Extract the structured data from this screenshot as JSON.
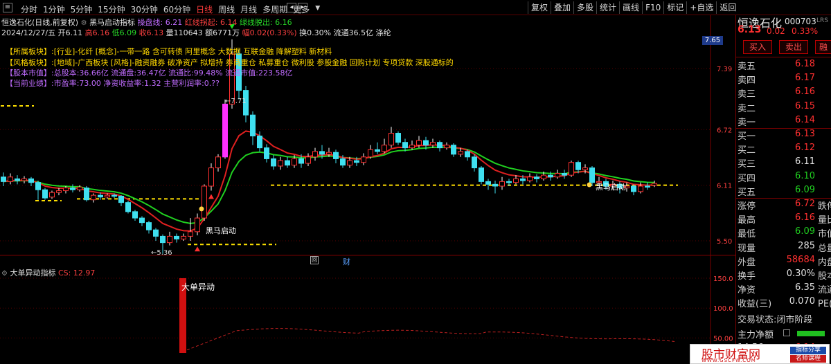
{
  "menu": {
    "period_tabs": [
      "分时",
      "1分钟",
      "5分钟",
      "15分钟",
      "30分钟",
      "60分钟",
      "日线",
      "周线",
      "月线",
      "多周期",
      "更多"
    ],
    "active_tab": "日线",
    "more_arrow": "▼",
    "right_tools": [
      "复权",
      "叠加",
      "多股",
      "统计",
      "画线",
      "F10",
      "标记",
      "+自选",
      "返回"
    ],
    "left_icon": "menu-icon",
    "nav_left_icon": "◂",
    "nav_right_icon": "▸"
  },
  "stock_header": {
    "title": "恒逸石化(日线,前复权)",
    "indicator": "黑马启动指标",
    "ind_caopan": "操盘线: 6.21",
    "ind_red": "红线拐起: 6.14",
    "ind_green": "绿线脱出: 6.16",
    "date": "2024/12/27/五",
    "open": "开6.11",
    "high": "高6.16",
    "low": "低6.09",
    "close": "收6.13",
    "volume": "量110643",
    "amount": "额6771万",
    "change": "幅0.02(0.33%)",
    "turnover": "换0.30%",
    "float_cap": "流通36.5亿",
    "industry_tag": "涤纶"
  },
  "info_panel": {
    "sector_label": "【所属板块】:",
    "sector_text": "[行业]-化纤 [概念]-一带一路 含可转债 阿里概念 大数据 互联金融 降解塑料 新材料",
    "style_label": "【风格板块】:",
    "style_text": "[地域]-广西板块 [风格]-融资融券 破净资产 拟增持 券商重仓 私募重仓 微利股 参股金融 回购计划 专项贷款 深股通标的",
    "capital_label": "【股本市值】:",
    "capital_text": "总股本:36.66亿 流通盘:36.47亿 流通比:99.48% 流通市值:223.58亿",
    "perf_label": "【当前业绩】:",
    "perf_text": "市盈率:73.00 净资收益率:1.32 主营利润率:0.??"
  },
  "chart_annotations": {
    "high_label": "7.71",
    "low_label": "5.36",
    "signal_label_1": "黑马启动",
    "signal_label_2": "黑马启动",
    "price_tag": "7.65",
    "event_box": "回",
    "event_cai": "财"
  },
  "chart_data": {
    "type": "candlestick",
    "y_ticks": [
      "7.39",
      "6.72",
      "6.11",
      "5.50"
    ],
    "candles": [
      {
        "o": 6.2,
        "c": 6.15,
        "h": 6.25,
        "l": 6.1
      },
      {
        "o": 6.15,
        "c": 6.2,
        "h": 6.24,
        "l": 6.12
      },
      {
        "o": 6.18,
        "c": 6.16,
        "h": 6.22,
        "l": 6.12
      },
      {
        "o": 6.16,
        "c": 6.18,
        "h": 6.21,
        "l": 6.13
      },
      {
        "o": 6.18,
        "c": 6.14,
        "h": 6.2,
        "l": 6.1
      },
      {
        "o": 6.14,
        "c": 6.06,
        "h": 6.16,
        "l": 5.95
      },
      {
        "o": 6.06,
        "c": 5.97,
        "h": 6.08,
        "l": 5.95
      },
      {
        "o": 5.98,
        "c": 6.03,
        "h": 6.05,
        "l": 5.96
      },
      {
        "o": 6.03,
        "c": 6.05,
        "h": 6.08,
        "l": 6.0
      },
      {
        "o": 6.05,
        "c": 6.08,
        "h": 6.1,
        "l": 6.02
      },
      {
        "o": 6.08,
        "c": 6.06,
        "h": 6.12,
        "l": 6.03
      },
      {
        "o": 6.06,
        "c": 6.09,
        "h": 6.11,
        "l": 6.04
      },
      {
        "o": 6.08,
        "c": 5.95,
        "h": 6.1,
        "l": 5.93
      },
      {
        "o": 5.95,
        "c": 6.0,
        "h": 6.02,
        "l": 5.92
      },
      {
        "o": 6.0,
        "c": 5.98,
        "h": 6.03,
        "l": 5.95
      },
      {
        "o": 5.98,
        "c": 6.0,
        "h": 6.02,
        "l": 5.96
      },
      {
        "o": 6.0,
        "c": 5.99,
        "h": 6.02,
        "l": 5.97
      },
      {
        "o": 5.99,
        "c": 5.92,
        "h": 6.0,
        "l": 5.88
      },
      {
        "o": 5.92,
        "c": 5.82,
        "h": 5.94,
        "l": 5.8
      },
      {
        "o": 5.82,
        "c": 5.75,
        "h": 5.84,
        "l": 5.72
      },
      {
        "o": 5.75,
        "c": 5.7,
        "h": 5.77,
        "l": 5.66
      },
      {
        "o": 5.7,
        "c": 5.62,
        "h": 5.72,
        "l": 5.58
      },
      {
        "o": 5.62,
        "c": 5.55,
        "h": 5.64,
        "l": 5.5
      },
      {
        "o": 5.55,
        "c": 5.48,
        "h": 5.57,
        "l": 5.36
      },
      {
        "o": 5.48,
        "c": 5.55,
        "h": 5.6,
        "l": 5.45
      },
      {
        "o": 5.55,
        "c": 5.52,
        "h": 5.58,
        "l": 5.48
      },
      {
        "o": 5.52,
        "c": 5.55,
        "h": 5.58,
        "l": 5.5
      },
      {
        "o": 5.55,
        "c": 5.6,
        "h": 5.75,
        "l": 5.5
      },
      {
        "o": 5.6,
        "c": 5.75,
        "h": 5.8,
        "l": 5.56
      },
      {
        "o": 5.75,
        "c": 6.1,
        "h": 6.12,
        "l": 5.72
      },
      {
        "o": 6.1,
        "c": 6.3,
        "h": 6.35,
        "l": 6.05
      },
      {
        "o": 6.3,
        "c": 6.42,
        "h": 6.45,
        "l": 6.26
      },
      {
        "o": 6.42,
        "c": 7.0,
        "h": 7.05,
        "l": 6.4
      },
      {
        "o": 7.0,
        "c": 7.55,
        "h": 7.71,
        "l": 6.95
      },
      {
        "o": 7.55,
        "c": 7.15,
        "h": 7.6,
        "l": 7.05
      },
      {
        "o": 7.15,
        "c": 6.88,
        "h": 7.2,
        "l": 6.8
      },
      {
        "o": 6.88,
        "c": 6.65,
        "h": 6.92,
        "l": 6.55
      },
      {
        "o": 6.65,
        "c": 6.52,
        "h": 6.7,
        "l": 6.48
      },
      {
        "o": 6.52,
        "c": 6.4,
        "h": 6.56,
        "l": 6.36
      },
      {
        "o": 6.4,
        "c": 6.32,
        "h": 6.44,
        "l": 6.28
      },
      {
        "o": 6.32,
        "c": 6.38,
        "h": 6.42,
        "l": 6.28
      },
      {
        "o": 6.38,
        "c": 6.33,
        "h": 6.42,
        "l": 6.3
      },
      {
        "o": 6.33,
        "c": 6.4,
        "h": 6.44,
        "l": 6.3
      },
      {
        "o": 6.4,
        "c": 6.35,
        "h": 6.45,
        "l": 6.3
      },
      {
        "o": 6.35,
        "c": 6.42,
        "h": 6.46,
        "l": 6.32
      },
      {
        "o": 6.42,
        "c": 6.48,
        "h": 6.52,
        "l": 6.38
      },
      {
        "o": 6.48,
        "c": 6.45,
        "h": 6.55,
        "l": 6.4
      },
      {
        "o": 6.45,
        "c": 6.47,
        "h": 6.52,
        "l": 6.42
      },
      {
        "o": 6.47,
        "c": 6.4,
        "h": 6.5,
        "l": 6.35
      },
      {
        "o": 6.4,
        "c": 6.33,
        "h": 6.44,
        "l": 6.3
      },
      {
        "o": 6.33,
        "c": 6.38,
        "h": 6.42,
        "l": 6.3
      },
      {
        "o": 6.38,
        "c": 6.36,
        "h": 6.42,
        "l": 6.32
      },
      {
        "o": 6.36,
        "c": 6.42,
        "h": 6.46,
        "l": 6.33
      },
      {
        "o": 6.42,
        "c": 6.5,
        "h": 6.55,
        "l": 6.4
      },
      {
        "o": 6.5,
        "c": 6.48,
        "h": 6.58,
        "l": 6.45
      },
      {
        "o": 6.48,
        "c": 6.55,
        "h": 6.62,
        "l": 6.46
      },
      {
        "o": 6.55,
        "c": 6.68,
        "h": 6.75,
        "l": 6.52
      },
      {
        "o": 6.68,
        "c": 6.58,
        "h": 6.7,
        "l": 6.55
      },
      {
        "o": 6.58,
        "c": 6.52,
        "h": 6.62,
        "l": 6.48
      },
      {
        "o": 6.52,
        "c": 6.55,
        "h": 6.6,
        "l": 6.5
      },
      {
        "o": 6.55,
        "c": 6.6,
        "h": 6.65,
        "l": 6.52
      },
      {
        "o": 6.6,
        "c": 6.55,
        "h": 6.64,
        "l": 6.5
      },
      {
        "o": 6.55,
        "c": 6.58,
        "h": 6.62,
        "l": 6.52
      },
      {
        "o": 6.58,
        "c": 6.52,
        "h": 6.6,
        "l": 6.48
      },
      {
        "o": 6.52,
        "c": 6.55,
        "h": 6.58,
        "l": 6.5
      },
      {
        "o": 6.55,
        "c": 6.45,
        "h": 6.57,
        "l": 6.42
      },
      {
        "o": 6.45,
        "c": 6.48,
        "h": 6.52,
        "l": 6.42
      },
      {
        "o": 6.48,
        "c": 6.42,
        "h": 6.5,
        "l": 6.38
      },
      {
        "o": 6.42,
        "c": 6.3,
        "h": 6.45,
        "l": 6.26
      },
      {
        "o": 6.3,
        "c": 6.15,
        "h": 6.32,
        "l": 6.12
      },
      {
        "o": 6.15,
        "c": 6.12,
        "h": 6.18,
        "l": 6.06
      },
      {
        "o": 6.12,
        "c": 6.1,
        "h": 6.16,
        "l": 6.02
      },
      {
        "o": 6.1,
        "c": 6.15,
        "h": 6.2,
        "l": 6.06
      },
      {
        "o": 6.15,
        "c": 6.14,
        "h": 6.18,
        "l": 6.1
      },
      {
        "o": 6.14,
        "c": 6.18,
        "h": 6.22,
        "l": 6.12
      },
      {
        "o": 6.18,
        "c": 6.16,
        "h": 6.22,
        "l": 6.12
      },
      {
        "o": 6.16,
        "c": 6.2,
        "h": 6.24,
        "l": 6.14
      },
      {
        "o": 6.2,
        "c": 6.18,
        "h": 6.23,
        "l": 6.14
      },
      {
        "o": 6.18,
        "c": 6.22,
        "h": 6.26,
        "l": 6.16
      },
      {
        "o": 6.22,
        "c": 6.2,
        "h": 6.26,
        "l": 6.16
      },
      {
        "o": 6.2,
        "c": 6.24,
        "h": 6.28,
        "l": 6.18
      },
      {
        "o": 6.24,
        "c": 6.22,
        "h": 6.28,
        "l": 6.18
      },
      {
        "o": 6.22,
        "c": 6.36,
        "h": 6.38,
        "l": 6.2
      },
      {
        "o": 6.36,
        "c": 6.28,
        "h": 6.38,
        "l": 6.24
      },
      {
        "o": 6.28,
        "c": 6.3,
        "h": 6.34,
        "l": 6.24
      },
      {
        "o": 6.3,
        "c": 6.14,
        "h": 6.32,
        "l": 6.1
      },
      {
        "o": 6.14,
        "c": 6.15,
        "h": 6.2,
        "l": 6.1
      },
      {
        "o": 6.15,
        "c": 6.1,
        "h": 6.18,
        "l": 6.06
      },
      {
        "o": 6.1,
        "c": 6.12,
        "h": 6.16,
        "l": 6.06
      },
      {
        "o": 6.12,
        "c": 6.08,
        "h": 6.15,
        "l": 6.02
      },
      {
        "o": 6.08,
        "c": 6.1,
        "h": 6.14,
        "l": 6.04
      },
      {
        "o": 6.1,
        "c": 6.04,
        "h": 6.12,
        "l": 6.0
      },
      {
        "o": 6.04,
        "c": 6.1,
        "h": 6.14,
        "l": 6.02
      },
      {
        "o": 6.1,
        "c": 6.09,
        "h": 6.14,
        "l": 6.06
      },
      {
        "o": 6.11,
        "c": 6.13,
        "h": 6.16,
        "l": 6.09
      }
    ],
    "dashed_levels": [
      {
        "price": 6.98,
        "from": 0,
        "to": 4
      },
      {
        "price": 5.94,
        "from": 5,
        "to": 8
      },
      {
        "price": 5.96,
        "from": 11,
        "to": 28
      },
      {
        "price": 5.46,
        "from": 27,
        "to": 39
      },
      {
        "price": 6.11,
        "from": 39,
        "to": 97
      }
    ],
    "sub_indicator": {
      "name": "大单异动指标",
      "cs_label": "CS: 12.97",
      "signal_label": "大单异动",
      "y_ticks": [
        "150.0",
        "100.0",
        "50.00"
      ],
      "bar_value": 150,
      "bar_index": 25
    }
  },
  "quote": {
    "name": "恒逸石化",
    "code": "000703",
    "code_suffix": "LRS",
    "price": "6.13",
    "change": "0.02",
    "pct": "0.33%",
    "buy_btn": "买入",
    "sell_btn": "卖出",
    "other_btn": "融",
    "asks": [
      {
        "label": "卖五",
        "price": "6.18"
      },
      {
        "label": "卖四",
        "price": "6.17"
      },
      {
        "label": "卖三",
        "price": "6.16"
      },
      {
        "label": "卖二",
        "price": "6.15"
      },
      {
        "label": "卖一",
        "price": "6.14"
      }
    ],
    "bids": [
      {
        "label": "买一",
        "price": "6.13"
      },
      {
        "label": "买二",
        "price": "6.12"
      },
      {
        "label": "买三",
        "price": "6.11"
      },
      {
        "label": "买四",
        "price": "6.10"
      },
      {
        "label": "买五",
        "price": "6.09"
      }
    ],
    "stats": [
      {
        "label": "涨停",
        "value": "6.72",
        "extra": "跌停"
      },
      {
        "label": "最高",
        "value": "6.16",
        "extra": "量比"
      },
      {
        "label": "最低",
        "value": "6.09",
        "extra": "市值"
      },
      {
        "label": "现量",
        "value": "285",
        "extra": "总量"
      },
      {
        "label": "外盘",
        "value": "58684",
        "extra": "内盘"
      },
      {
        "label": "换手",
        "value": "0.30%",
        "extra": "股本"
      },
      {
        "label": "净资",
        "value": "6.35",
        "extra": "流通"
      },
      {
        "label": "收益(三)",
        "value": "0.070",
        "extra": "PE(动"
      }
    ],
    "trade_status_label": "交易状态:",
    "trade_status_value": "闭市阶段",
    "net_flow_label": "主力净额",
    "tick_time": "14:56",
    "tick_price": "6.14"
  },
  "watermark": {
    "title": "股市财富网",
    "url": "WWW.GSCFW.COM",
    "tag1": "指标分享",
    "tag2": "名师课程"
  },
  "colors": {
    "up": "#ff3030",
    "down": "#3fe0f0",
    "red_line": "#e02020",
    "green_line": "#20d020",
    "dash": "#ffe000",
    "magenta": "#ff30ff"
  }
}
